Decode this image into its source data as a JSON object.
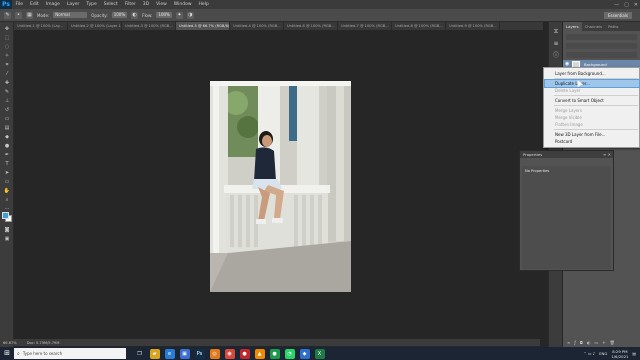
{
  "app": {
    "logo": "Ps"
  },
  "menu": [
    "File",
    "Edit",
    "Image",
    "Layer",
    "Type",
    "Select",
    "Filter",
    "3D",
    "View",
    "Window",
    "Help"
  ],
  "window_controls": [
    "—",
    "▢",
    "✕"
  ],
  "options": {
    "mode_label": "Mode:",
    "mode_value": "Normal",
    "opacity_label": "Opacity:",
    "opacity_value": "100%",
    "flow_label": "Flow:",
    "flow_value": "100%",
    "workspace": "Essentials"
  },
  "tabs": [
    "Untitled-1 @ 100% (Lay...",
    "Untitled-2 @ 100% (Layer 1, RGB/8)",
    "Untitled-3 @ 100% (RGB...",
    "Untitled-5 @ 66.7% (RGB/8)",
    "Untitled-4 @ 100% (RGB...",
    "Untitled-6 @ 100% (RGB...",
    "Untitled-7 @ 100% (RGB...",
    "Untitled-8 @ 100% (RGB...",
    "Untitled-9 @ 100% (RGB..."
  ],
  "active_tab_index": 3,
  "status": {
    "zoom": "66.67%",
    "doc": "Doc: 5.79M/5.79M"
  },
  "layers_panel": {
    "tabs": [
      "Layers",
      "Channels",
      "Paths"
    ],
    "layer_name": "Background"
  },
  "context_menu": {
    "items": [
      {
        "label": "Layer from Background...",
        "disabled": false,
        "highlight": false
      },
      {
        "label": "Duplicate Layer...",
        "disabled": false,
        "highlight": true
      },
      {
        "label": "Delete Layer",
        "disabled": true,
        "highlight": false
      },
      {
        "label": "Convert to Smart Object",
        "disabled": false,
        "highlight": false
      },
      {
        "label": "Merge Layers",
        "disabled": true,
        "highlight": false
      },
      {
        "label": "Merge Visible",
        "disabled": true,
        "highlight": false
      },
      {
        "label": "Flatten Image",
        "disabled": true,
        "highlight": false
      },
      {
        "label": "New 3D Layer from File...",
        "disabled": false,
        "highlight": false
      },
      {
        "label": "Postcard",
        "disabled": false,
        "highlight": false
      }
    ]
  },
  "properties": {
    "title": "Properties",
    "subtitle": "No Properties"
  },
  "taskbar": {
    "search_placeholder": "Type here to search",
    "time": "8:29 PM",
    "date": "1/6/2021",
    "lang": "ENG",
    "apps": [
      {
        "name": "task-view",
        "glyph": "❐",
        "color": "#1c2533"
      },
      {
        "name": "file-explorer",
        "glyph": "▰",
        "color": "#d9a420"
      },
      {
        "name": "edge",
        "glyph": "e",
        "color": "#2a7bd6"
      },
      {
        "name": "store",
        "glyph": "▣",
        "color": "#3b6fd0"
      },
      {
        "name": "photoshop",
        "glyph": "Ps",
        "color": "#0f2e4a"
      },
      {
        "name": "search-app",
        "glyph": "◎",
        "color": "#e07a1a"
      },
      {
        "name": "chrome",
        "glyph": "◉",
        "color": "#d64a3b"
      },
      {
        "name": "app-red",
        "glyph": "●",
        "color": "#c0272d"
      },
      {
        "name": "vlc",
        "glyph": "▲",
        "color": "#f08a00"
      },
      {
        "name": "app-green",
        "glyph": "●",
        "color": "#1d9b4a"
      },
      {
        "name": "whatsapp",
        "glyph": "◔",
        "color": "#25d366"
      },
      {
        "name": "app-blue",
        "glyph": "◆",
        "color": "#2c6fce"
      },
      {
        "name": "excel",
        "glyph": "X",
        "color": "#1e7b45"
      }
    ]
  }
}
